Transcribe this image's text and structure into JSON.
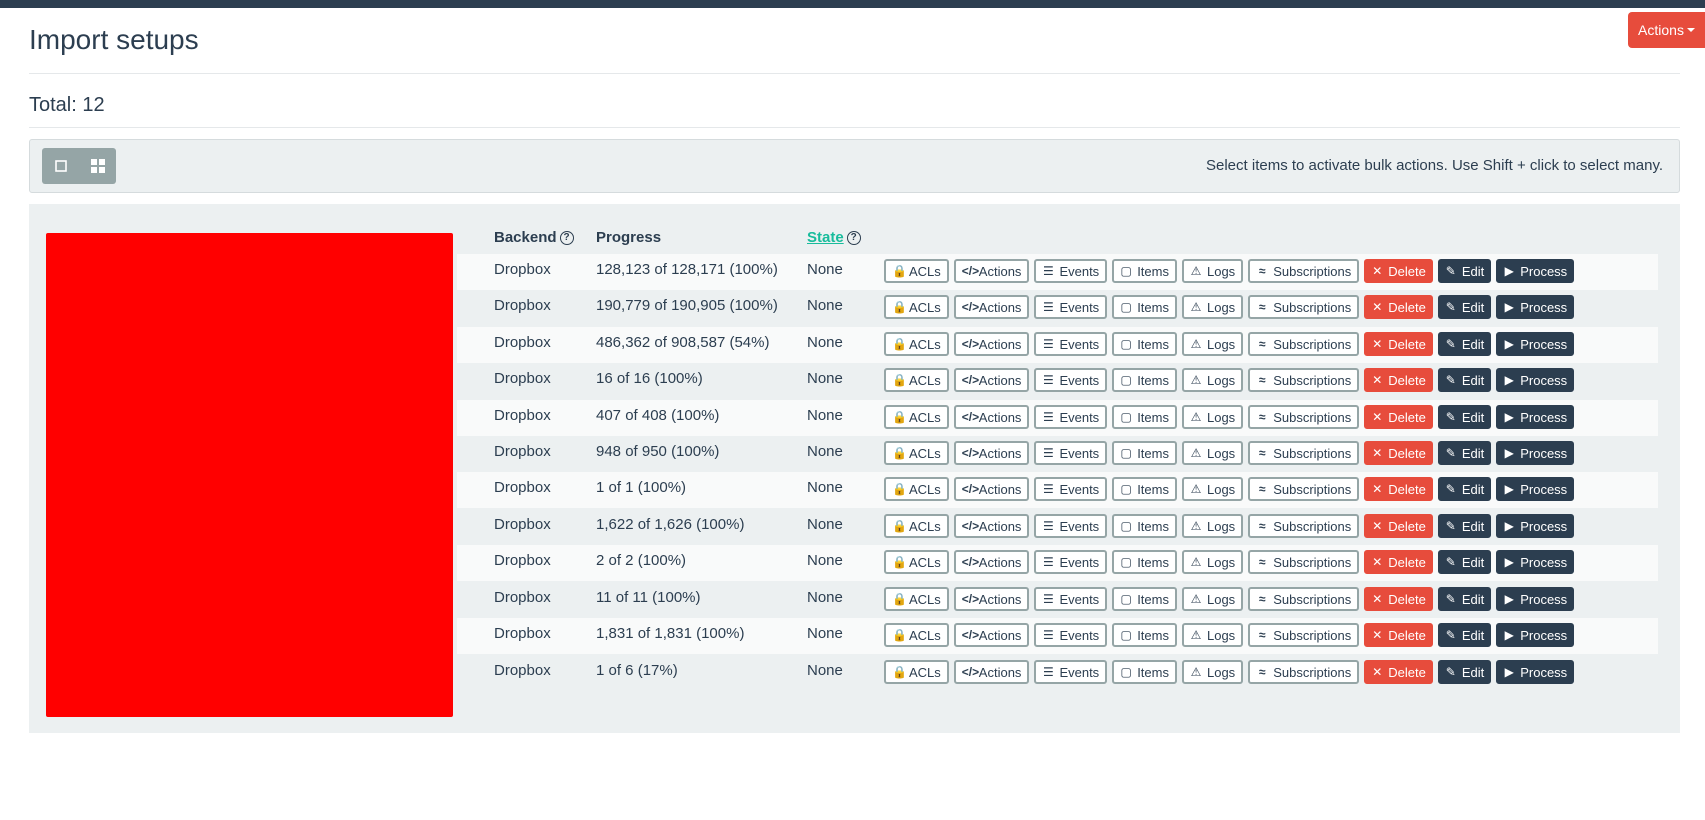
{
  "header": {
    "actions_label": "Actions"
  },
  "page": {
    "title": "Import setups",
    "total": "Total: 12"
  },
  "toolbar": {
    "bulk_hint": "Select items to activate bulk actions. Use Shift + click to select many."
  },
  "table": {
    "columns": {
      "backend": "Backend",
      "progress": "Progress",
      "state": "State"
    },
    "buttons": {
      "acls": "ACLs",
      "actions": "Actions",
      "events": "Events",
      "items": "Items",
      "logs": "Logs",
      "subscriptions": "Subscriptions",
      "delete": "Delete",
      "edit": "Edit",
      "process": "Process"
    },
    "rows": [
      {
        "backend": "Dropbox",
        "progress": "128,123 of 128,171 (100%)",
        "state": "None"
      },
      {
        "backend": "Dropbox",
        "progress": "190,779 of 190,905 (100%)",
        "state": "None"
      },
      {
        "backend": "Dropbox",
        "progress": "486,362 of 908,587 (54%)",
        "state": "None"
      },
      {
        "backend": "Dropbox",
        "progress": "16 of 16 (100%)",
        "state": "None"
      },
      {
        "backend": "Dropbox",
        "progress": "407 of 408 (100%)",
        "state": "None"
      },
      {
        "backend": "Dropbox",
        "progress": "948 of 950 (100%)",
        "state": "None"
      },
      {
        "backend": "Dropbox",
        "progress": "1 of 1 (100%)",
        "state": "None"
      },
      {
        "backend": "Dropbox",
        "progress": "1,622 of 1,626 (100%)",
        "state": "None"
      },
      {
        "backend": "Dropbox",
        "progress": "2 of 2 (100%)",
        "state": "None"
      },
      {
        "backend": "Dropbox",
        "progress": "11 of 11 (100%)",
        "state": "None"
      },
      {
        "backend": "Dropbox",
        "progress": "1,831 of 1,831 (100%)",
        "state": "None"
      },
      {
        "backend": "Dropbox",
        "progress": "1 of 6 (17%)",
        "state": "None"
      }
    ]
  },
  "colors": {
    "primary": "#2c3e50",
    "danger": "#e74c3c",
    "accent": "#18bc9c",
    "muted": "#95a5a6",
    "panel": "#ecf0f1"
  }
}
